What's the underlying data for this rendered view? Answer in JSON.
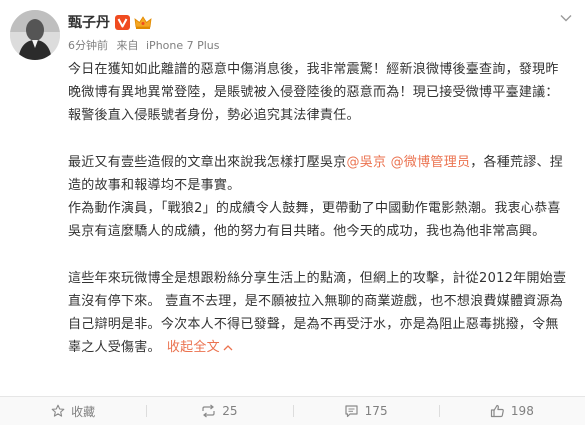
{
  "post": {
    "user": {
      "name": "甄子丹",
      "verified_icon": "v-verified-icon",
      "vip_icon": "crown-icon"
    },
    "meta": {
      "time": "6分钟前",
      "source_prefix": "来自",
      "device": "iPhone 7 Plus"
    },
    "menu_icon": "chevron-down-icon",
    "paragraphs": {
      "p1": "今日在獲知如此離譜的惡意中傷消息後，我非常震驚！經新浪微博後臺查詢，發現昨晚微博有異地異常登陸，是賬號被入侵登陸後的惡意而為！現已接受微博平臺建議：報警後直入侵賬號者身份，勢必追究其法律責任。",
      "p2_before": "最近又有壹些造假的文章出來說我怎樣打壓吳京",
      "p2_mention1": "@吳京",
      "p2_mention2": "@微博管理员",
      "p2_after": "，各種荒謬、捏造的故事和報導均不是事實。",
      "p3": "作為動作演員，「戰狼2」的成績令人鼓舞，更帶動了中國動作電影熱潮。我衷心恭喜吳京有這麼驕人的成績，他的努力有目共睹。他今天的成功，我也為他非常高興。",
      "p4": "這些年來玩微博全是想跟粉絲分享生活上的點滴，但網上的攻擊，計從2012年開始壹直沒有停下來。 壹直不去理，是不願被拉入無聊的商業遊戲，也不想浪費媒體資源為自己辯明是非。今次本人不得已發聲，是為不再受汙水，亦是為阻止惡毒挑撥，令無辜之人受傷害。",
      "collapse_label": "收起全文"
    },
    "actions": {
      "favorite": {
        "label": "收藏",
        "icon": "star-icon"
      },
      "repost": {
        "count": "25",
        "icon": "repost-icon"
      },
      "comment": {
        "count": "175",
        "icon": "comment-icon"
      },
      "like": {
        "count": "198",
        "icon": "thumbs-up-icon"
      }
    },
    "colors": {
      "link": "#eb7350",
      "text": "#333333",
      "meta": "#808080",
      "verified": "#f04b20"
    }
  }
}
